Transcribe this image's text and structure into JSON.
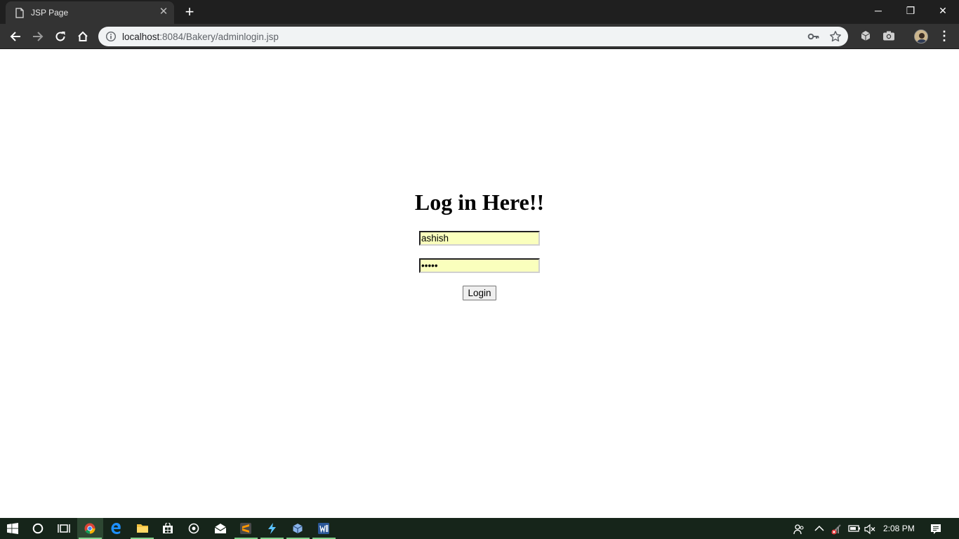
{
  "browser": {
    "tab_title": "JSP Page",
    "tab_close_glyph": "✕",
    "new_tab_glyph": "+",
    "url_host": "localhost",
    "url_rest": ":8084/Bakery/adminlogin.jsp",
    "window_controls": {
      "minimize": "─",
      "restore": "❐",
      "close": "✕"
    },
    "menu_glyph": "⋮"
  },
  "page": {
    "heading": "Log in Here!!",
    "username_value": "ashish",
    "password_value": "ashis",
    "login_label": "Login",
    "autofill_color": "#faffbd"
  },
  "taskbar": {
    "apps": [
      "windows-start-icon",
      "cortana-icon",
      "task-view-icon",
      "chrome-icon",
      "edge-icon",
      "file-explorer-icon",
      "store-icon",
      "media-icon",
      "mail-icon",
      "sublime-text-icon",
      "app-bolt-icon",
      "virtualbox-icon",
      "word-icon"
    ],
    "clock": "2:08 PM"
  }
}
